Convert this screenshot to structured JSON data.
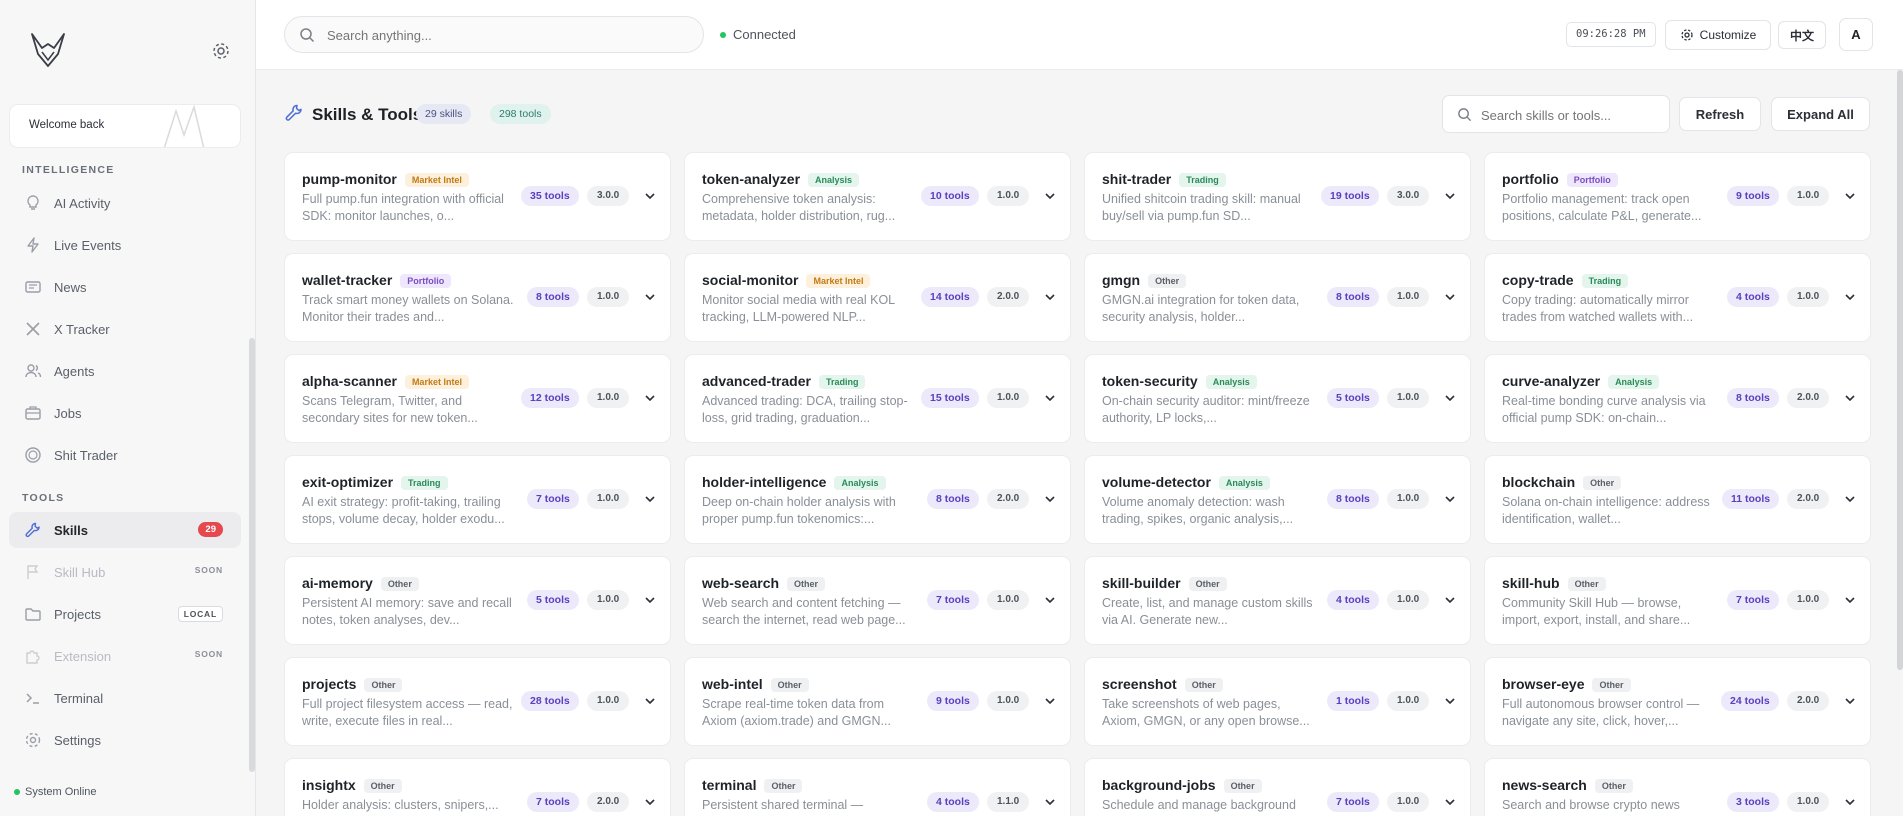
{
  "sidebar": {
    "welcome": "Welcome back",
    "sections": {
      "intelligence": "INTELLIGENCE",
      "tools": "TOOLS"
    },
    "nav": [
      {
        "label": "AI Activity",
        "icon": "bulb-icon"
      },
      {
        "label": "Live Events",
        "icon": "bolt-icon"
      },
      {
        "label": "News",
        "icon": "newspaper-icon"
      },
      {
        "label": "X Tracker",
        "icon": "x-logo-icon"
      },
      {
        "label": "Agents",
        "icon": "users-icon"
      },
      {
        "label": "Jobs",
        "icon": "briefcase-icon"
      },
      {
        "label": "Shit Trader",
        "icon": "target-icon"
      },
      {
        "label": "Skills",
        "icon": "wrench-icon",
        "badge": "29",
        "active": true
      },
      {
        "label": "Skill Hub",
        "icon": "flag-icon",
        "badge": "SOON",
        "disabled": true
      },
      {
        "label": "Projects",
        "icon": "folder-icon",
        "badge": "LOCAL"
      },
      {
        "label": "Extension",
        "icon": "puzzle-icon",
        "badge": "SOON",
        "disabled": true
      },
      {
        "label": "Terminal",
        "icon": "terminal-icon"
      },
      {
        "label": "Settings",
        "icon": "gear-icon"
      }
    ],
    "status": "System Online"
  },
  "topbar": {
    "search_placeholder": "Search anything...",
    "connection": "Connected",
    "clock": "09:26:28 PM",
    "customize": "Customize",
    "language": "中文",
    "avatar": "A"
  },
  "main": {
    "title": "Skills & Tools",
    "skills_count": "29 skills",
    "tools_count": "298 tools",
    "search_placeholder": "Search skills or tools...",
    "refresh": "Refresh",
    "expand_all": "Expand All",
    "cards": [
      {
        "name": "pump-monitor",
        "tag": "Market Intel",
        "desc": "Full pump.fun integration with official SDK: monitor launches, o...",
        "tools": "35 tools",
        "version": "3.0.0"
      },
      {
        "name": "token-analyzer",
        "tag": "Analysis",
        "desc": "Comprehensive token analysis: metadata, holder distribution, rug...",
        "tools": "10 tools",
        "version": "1.0.0"
      },
      {
        "name": "shit-trader",
        "tag": "Trading",
        "desc": "Unified shitcoin trading skill: manual buy/sell via pump.fun SD...",
        "tools": "19 tools",
        "version": "3.0.0"
      },
      {
        "name": "portfolio",
        "tag": "Portfolio",
        "desc": "Portfolio management: track open positions, calculate P&L, generate...",
        "tools": "9 tools",
        "version": "1.0.0"
      },
      {
        "name": "wallet-tracker",
        "tag": "Portfolio",
        "desc": "Track smart money wallets on Solana. Monitor their trades and...",
        "tools": "8 tools",
        "version": "1.0.0"
      },
      {
        "name": "social-monitor",
        "tag": "Market Intel",
        "desc": "Monitor social media with real KOL tracking, LLM-powered NLP...",
        "tools": "14 tools",
        "version": "2.0.0"
      },
      {
        "name": "gmgn",
        "tag": "Other",
        "desc": "GMGN.ai integration for token data, security analysis, holder...",
        "tools": "8 tools",
        "version": "1.0.0"
      },
      {
        "name": "copy-trade",
        "tag": "Trading",
        "desc": "Copy trading: automatically mirror trades from watched wallets with...",
        "tools": "4 tools",
        "version": "1.0.0"
      },
      {
        "name": "alpha-scanner",
        "tag": "Market Intel",
        "desc": "Scans Telegram, Twitter, and secondary sites for new token...",
        "tools": "12 tools",
        "version": "1.0.0"
      },
      {
        "name": "advanced-trader",
        "tag": "Trading",
        "desc": "Advanced trading: DCA, trailing stop-loss, grid trading, graduation...",
        "tools": "15 tools",
        "version": "1.0.0"
      },
      {
        "name": "token-security",
        "tag": "Analysis",
        "desc": "On-chain security auditor: mint/freeze authority, LP locks,...",
        "tools": "5 tools",
        "version": "1.0.0"
      },
      {
        "name": "curve-analyzer",
        "tag": "Analysis",
        "desc": "Real-time bonding curve analysis via official pump SDK: on-chain...",
        "tools": "8 tools",
        "version": "2.0.0"
      },
      {
        "name": "exit-optimizer",
        "tag": "Trading",
        "desc": "AI exit strategy: profit-taking, trailing stops, volume decay, holder exodu...",
        "tools": "7 tools",
        "version": "1.0.0"
      },
      {
        "name": "holder-intelligence",
        "tag": "Analysis",
        "desc": "Deep on-chain holder analysis with proper pump.fun tokenomics:...",
        "tools": "8 tools",
        "version": "2.0.0"
      },
      {
        "name": "volume-detector",
        "tag": "Analysis",
        "desc": "Volume anomaly detection: wash trading, spikes, organic analysis,...",
        "tools": "8 tools",
        "version": "1.0.0"
      },
      {
        "name": "blockchain",
        "tag": "Other",
        "desc": "Solana on-chain intelligence: address identification, wallet...",
        "tools": "11 tools",
        "version": "2.0.0"
      },
      {
        "name": "ai-memory",
        "tag": "Other",
        "desc": "Persistent AI memory: save and recall notes, token analyses, dev...",
        "tools": "5 tools",
        "version": "1.0.0"
      },
      {
        "name": "web-search",
        "tag": "Other",
        "desc": "Web search and content fetching — search the internet, read web page...",
        "tools": "7 tools",
        "version": "1.0.0"
      },
      {
        "name": "skill-builder",
        "tag": "Other",
        "desc": "Create, list, and manage custom skills via AI. Generate new...",
        "tools": "4 tools",
        "version": "1.0.0"
      },
      {
        "name": "skill-hub",
        "tag": "Other",
        "desc": "Community Skill Hub — browse, import, export, install, and share...",
        "tools": "7 tools",
        "version": "1.0.0"
      },
      {
        "name": "projects",
        "tag": "Other",
        "desc": "Full project filesystem access — read, write, execute files in real...",
        "tools": "28 tools",
        "version": "1.0.0"
      },
      {
        "name": "web-intel",
        "tag": "Other",
        "desc": "Scrape real-time token data from Axiom (axiom.trade) and GMGN...",
        "tools": "9 tools",
        "version": "1.0.0"
      },
      {
        "name": "screenshot",
        "tag": "Other",
        "desc": "Take screenshots of web pages, Axiom, GMGN, or any open browse...",
        "tools": "1 tools",
        "version": "1.0.0"
      },
      {
        "name": "browser-eye",
        "tag": "Other",
        "desc": "Full autonomous browser control — navigate any site, click, hover,...",
        "tools": "24 tools",
        "version": "2.0.0"
      },
      {
        "name": "insightx",
        "tag": "Other",
        "desc": "Holder analysis: clusters, snipers,...",
        "tools": "7 tools",
        "version": "2.0.0"
      },
      {
        "name": "terminal",
        "tag": "Other",
        "desc": "Persistent shared terminal —",
        "tools": "4 tools",
        "version": "1.1.0"
      },
      {
        "name": "background-jobs",
        "tag": "Other",
        "desc": "Schedule and manage background",
        "tools": "7 tools",
        "version": "1.0.0"
      },
      {
        "name": "news-search",
        "tag": "Other",
        "desc": "Search and browse crypto news",
        "tools": "3 tools",
        "version": "1.0.0"
      }
    ]
  }
}
